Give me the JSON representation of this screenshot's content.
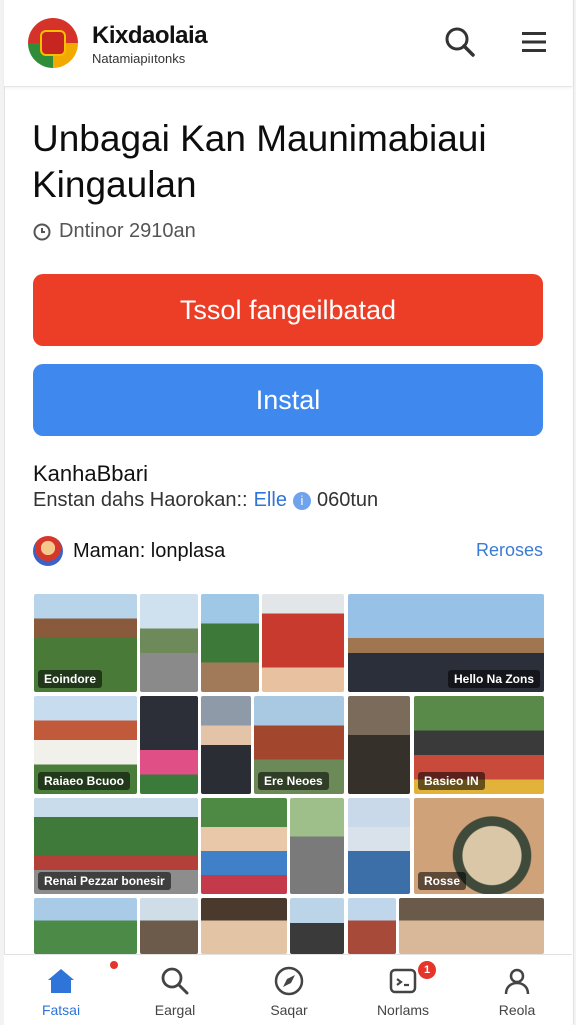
{
  "header": {
    "brand_name": "Kixdaolaia",
    "brand_sub": "Natamiapiıtonks",
    "icons": [
      "search-icon",
      "menu-icon"
    ]
  },
  "main": {
    "title": "Unbagai Kan Maunimabiaui Kingaulan",
    "meta": "Dntinor 2910an",
    "primary_button": "Tssol fangeilbatad",
    "install_button": "Instal",
    "section_title": "KanhaBbari",
    "section_line_text": "Enstan dahs Haorokan::",
    "section_line_link": "Elle",
    "section_line_count": "060tun",
    "user_name": "Maman: lonplasa",
    "reroses": "Reroses"
  },
  "gallery": {
    "captions": [
      "Eoindore",
      "Hello Na Zons",
      "Raiaeo Bcuoo",
      "Ere Neoes",
      "Basieo IN",
      "Renai Pezzar bonesir",
      "Rosse"
    ]
  },
  "nav": {
    "items": [
      {
        "label": "Fatsai",
        "icon": "home-icon",
        "active": true
      },
      {
        "label": "Eargal",
        "icon": "search-icon",
        "active": false
      },
      {
        "label": "Saqar",
        "icon": "compass-icon",
        "active": false
      },
      {
        "label": "Norlams",
        "icon": "notification-icon",
        "active": false
      },
      {
        "label": "Reola",
        "icon": "profile-icon",
        "active": false
      }
    ],
    "notification_count": "1"
  },
  "colors": {
    "primary_red": "#ec3d26",
    "install_blue": "#3f88ee",
    "link_blue": "#2f74d8"
  }
}
